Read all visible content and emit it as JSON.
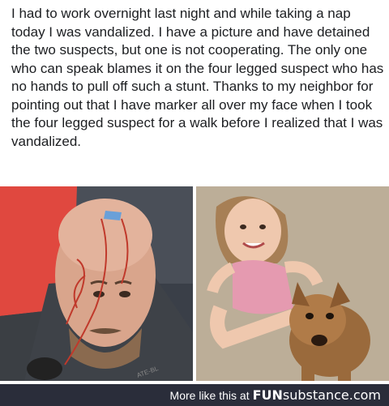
{
  "post": {
    "text": "I had to work overnight last night and while taking a nap today I was vandalized. I have a picture and have detained the two suspects, but one is not cooperating.  The only one who can speak blames it on the four legged suspect who has no hands to pull off such a stunt. Thanks to my neighbor for pointing out that I have marker all over my face when I took the four legged suspect for a walk before I realized that I was vandalized."
  },
  "footer": {
    "more_like_this": "More like this at",
    "brand_fun": "FUN",
    "brand_substance": "substance",
    "brand_dot": ".",
    "brand_com": "com"
  }
}
